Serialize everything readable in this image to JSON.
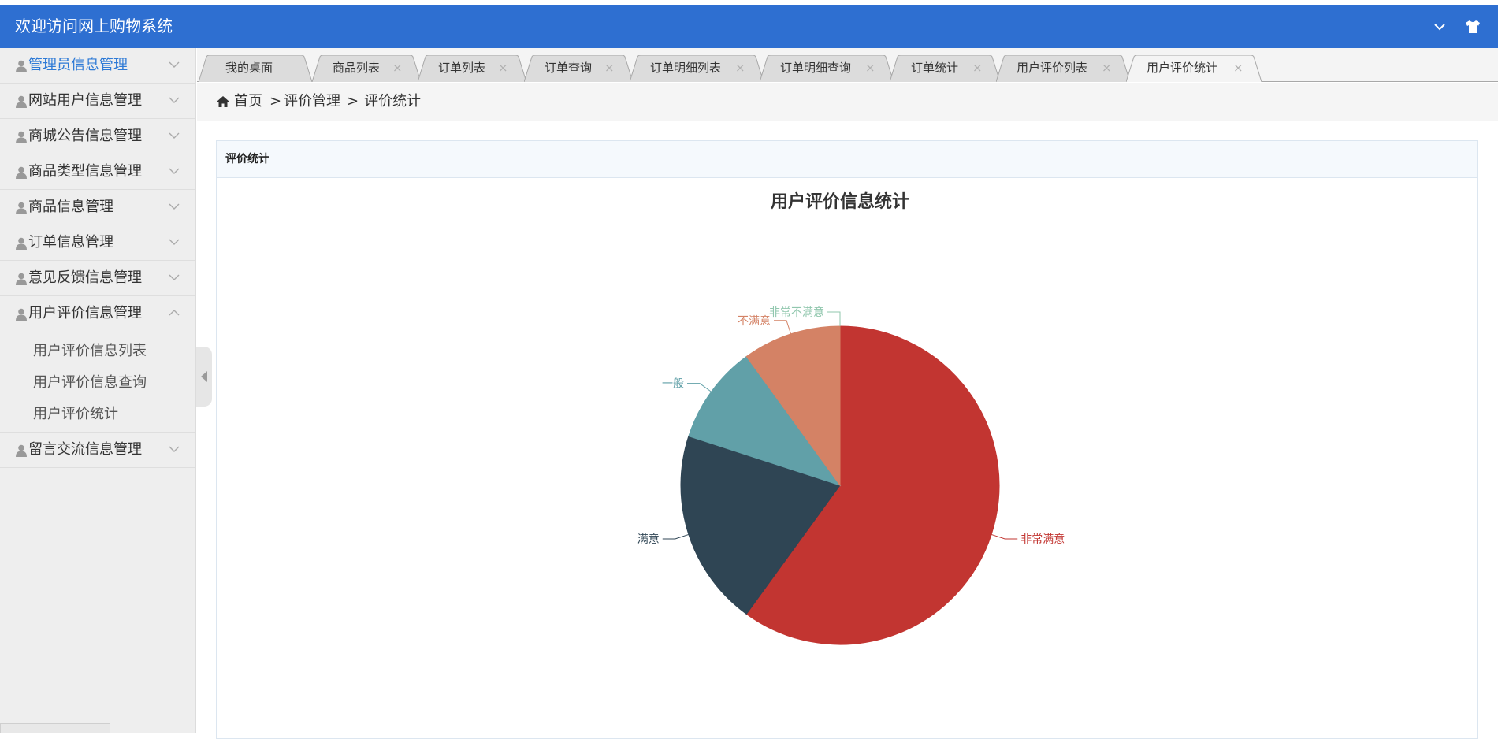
{
  "header": {
    "title": "欢迎访问网上购物系统"
  },
  "sidebar": {
    "items": [
      {
        "label": "管理员信息管理"
      },
      {
        "label": "网站用户信息管理"
      },
      {
        "label": "商城公告信息管理"
      },
      {
        "label": "商品类型信息管理"
      },
      {
        "label": "商品信息管理"
      },
      {
        "label": "订单信息管理"
      },
      {
        "label": "意见反馈信息管理"
      },
      {
        "label": "用户评价信息管理"
      },
      {
        "label": "留言交流信息管理"
      }
    ],
    "submenu": [
      {
        "label": "用户评价信息列表"
      },
      {
        "label": "用户评价信息查询"
      },
      {
        "label": "用户评价统计"
      }
    ]
  },
  "tabs": [
    {
      "label": "我的桌面"
    },
    {
      "label": "商品列表"
    },
    {
      "label": "订单列表"
    },
    {
      "label": "订单查询"
    },
    {
      "label": "订单明细列表"
    },
    {
      "label": "订单明细查询"
    },
    {
      "label": "订单统计"
    },
    {
      "label": "用户评价列表"
    },
    {
      "label": "用户评价统计"
    }
  ],
  "tab_close_glyph": "×",
  "breadcrumb": {
    "home": "首页",
    "sep": ">",
    "level1": "评价管理",
    "level2": "评价统计"
  },
  "panel": {
    "title": "评价统计"
  },
  "chart_data": {
    "type": "pie",
    "title": "用户评价信息统计",
    "slices": [
      {
        "name": "非常满意",
        "value": 6,
        "color": "#c23531"
      },
      {
        "name": "满意",
        "value": 2,
        "color": "#2f4554"
      },
      {
        "name": "一般",
        "value": 1,
        "color": "#61a0a8"
      },
      {
        "name": "不满意",
        "value": 1,
        "color": "#d48265"
      },
      {
        "name": "非常不满意",
        "value": 0,
        "color": "#91c7ae"
      }
    ]
  },
  "colors": {
    "header_bg": "#2e6fd1",
    "active_menu": "#2e7ad6"
  }
}
